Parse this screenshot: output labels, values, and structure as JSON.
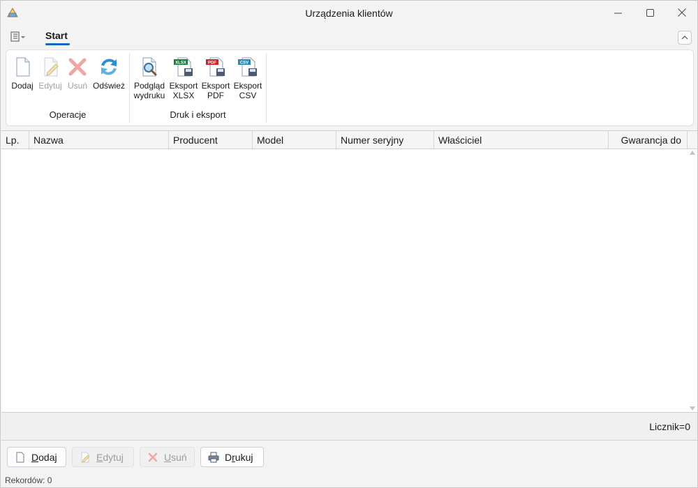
{
  "window": {
    "title": "Urządzenia klientów",
    "minimize_glyph": "—",
    "maximize_glyph": "☐",
    "close_glyph": "✕"
  },
  "ribbon": {
    "tab_label": "Start",
    "collapse_glyph": "^",
    "groups": [
      {
        "label": "Operacje",
        "buttons": [
          {
            "label": "Dodaj",
            "icon": "new-document-icon",
            "enabled": true
          },
          {
            "label": "Edytuj",
            "icon": "edit-document-icon",
            "enabled": false
          },
          {
            "label": "Usuń",
            "icon": "delete-icon",
            "enabled": false
          },
          {
            "label": "Odśwież",
            "icon": "refresh-icon",
            "enabled": true
          }
        ]
      },
      {
        "label": "Druk i eksport",
        "buttons": [
          {
            "label": "Podgląd wydruku",
            "line1": "Podgląd",
            "line2": "wydruku",
            "icon": "print-preview-icon",
            "enabled": true
          },
          {
            "label": "Eksport XLSX",
            "line1": "Eksport",
            "line2": "XLSX",
            "icon": "export-xlsx-icon",
            "badge": "XLSX",
            "enabled": true
          },
          {
            "label": "Eksport PDF",
            "line1": "Eksport",
            "line2": "PDF",
            "icon": "export-pdf-icon",
            "badge": "PDF",
            "enabled": true
          },
          {
            "label": "Eksport CSV",
            "line1": "Eksport",
            "line2": "CSV",
            "icon": "export-csv-icon",
            "badge": "CSV",
            "enabled": true
          }
        ]
      }
    ]
  },
  "grid": {
    "columns": [
      "Lp.",
      "Nazwa",
      "Producent",
      "Model",
      "Numer seryjny",
      "Właściciel",
      "Gwarancja do"
    ],
    "rows": []
  },
  "footer": {
    "counter": "Licznik=0",
    "buttons": [
      {
        "label": "Dodaj",
        "accel": "D",
        "rest": "odaj",
        "icon": "new-document-icon",
        "enabled": true
      },
      {
        "label": "Edytuj",
        "accel": "E",
        "rest": "dytuj",
        "icon": "edit-document-icon",
        "enabled": false
      },
      {
        "label": "Usuń",
        "accel": "U",
        "rest": "suń",
        "icon": "delete-icon",
        "enabled": false
      },
      {
        "label": "Drukuj",
        "pre": "D",
        "accel": "r",
        "rest": "ukuj",
        "icon": "printer-icon",
        "enabled": true
      }
    ],
    "status": "Rekordów: 0"
  },
  "colors": {
    "accent": "#1467bf",
    "xlsx_badge": "#1d7a3e",
    "pdf_badge": "#c0282d",
    "csv_badge": "#2e86b5",
    "refresh": "#2d8fd0",
    "delete": "#e07070"
  }
}
